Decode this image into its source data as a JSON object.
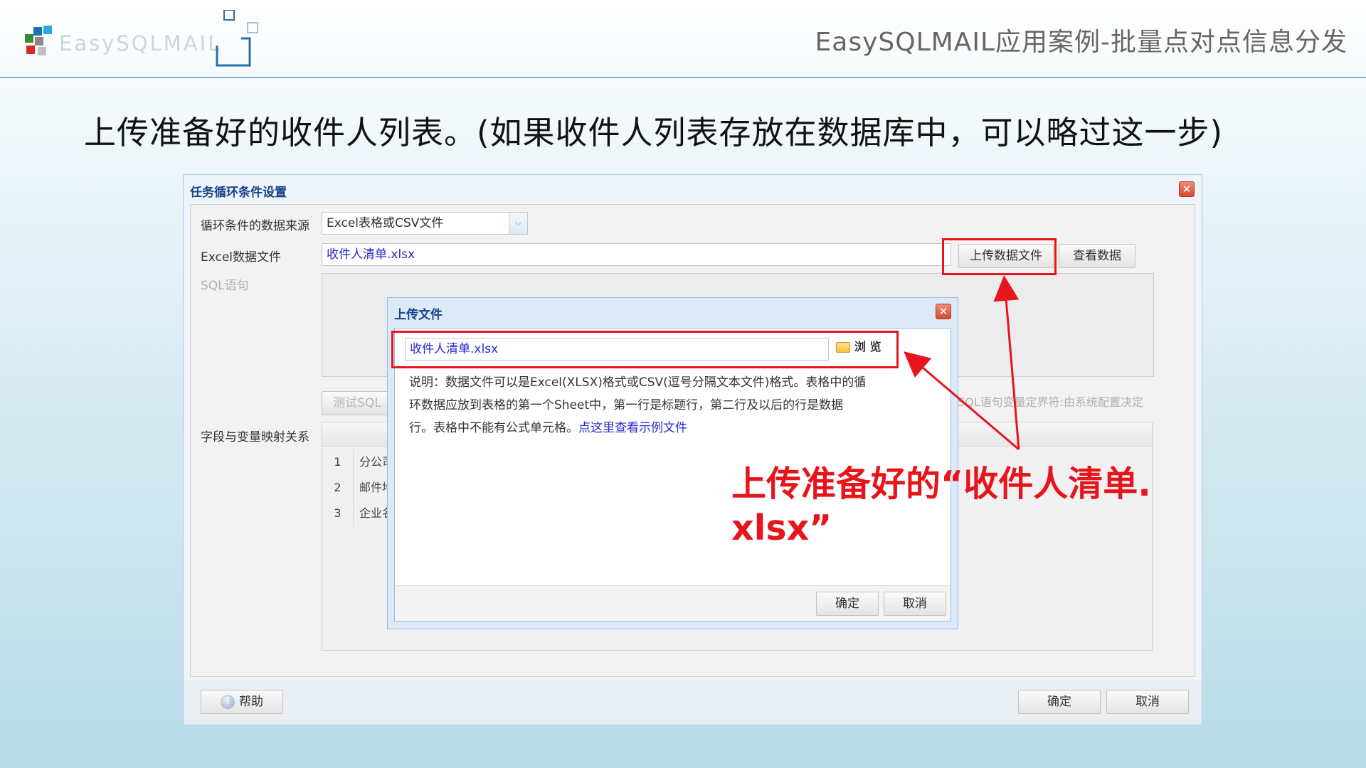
{
  "header": {
    "logo_text": "EasySQLMAIL",
    "slide_title": "EasySQLMAIL应用案例-批量点对点信息分发",
    "subtitle": "上传准备好的收件人列表。(如果收件人列表存放在数据库中，可以略过这一步)"
  },
  "main_window": {
    "title": "任务循环条件设置",
    "source_label": "循环条件的数据来源",
    "source_value": "Excel表格或CSV文件",
    "excel_file_label": "Excel数据文件",
    "excel_file_value": "收件人清单.xlsx",
    "upload_button": "上传数据文件",
    "view_button": "查看数据",
    "sql_label": "SQL语句",
    "test_sql_button": "测试SQL",
    "sql_delimiter_note": "SQL语句变量定界符:由系统配置决定",
    "mapping_label": "字段与变量映射关系",
    "rows": [
      {
        "num": "1",
        "text": "分公司"
      },
      {
        "num": "2",
        "text": "邮件地"
      },
      {
        "num": "3",
        "text": "企业名"
      }
    ],
    "help_button": "帮助",
    "ok_button": "确定",
    "cancel_button": "取消"
  },
  "upload_dialog": {
    "title": "上传文件",
    "file_value": "收件人清单.xlsx",
    "browse_button": "浏 览",
    "desc_line1": "说明：数据文件可以是Excel(XLSX)格式或CSV(逗号分隔文本文件)格式。表格中的循",
    "desc_line2": "环数据应放到表格的第一个Sheet中，第一行是标题行，第二行及以后的行是数据",
    "desc_line3": "行。表格中不能有公式单元格。",
    "desc_link": "点这里查看示例文件",
    "ok_button": "确定",
    "cancel_button": "取消"
  },
  "annotation": {
    "line1": "上传准备好的“收件人清单.",
    "line2": "xlsx”"
  },
  "colors": {
    "accent_red": "#e8141c",
    "title_blue": "#15428b",
    "link_blue": "#2828d0"
  }
}
